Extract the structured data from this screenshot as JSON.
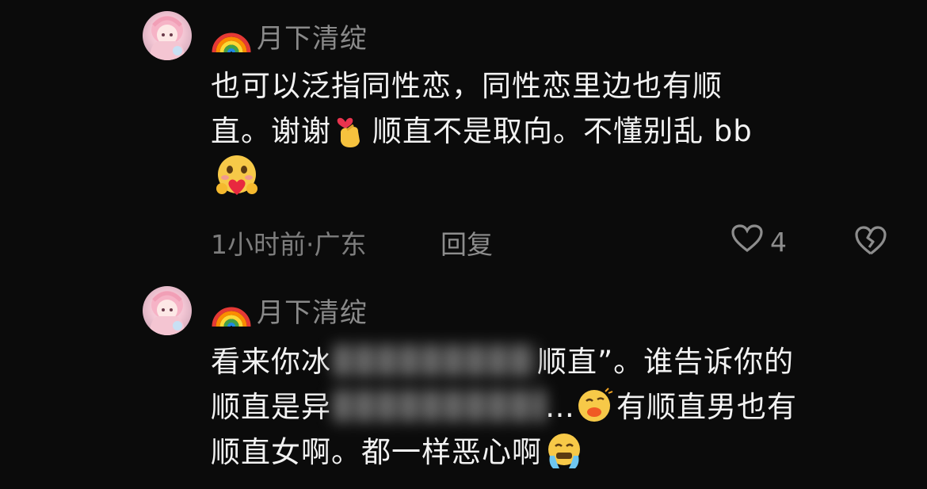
{
  "comments": [
    {
      "username": "月下清绽",
      "badge_icon": "rainbow-icon",
      "lines": [
        {
          "parts": [
            "也可以泛指同性恋，同性恋里边也有顺"
          ]
        },
        {
          "parts": [
            "直。谢谢",
            "顺直不是取向。不懂别乱 bb"
          ]
        }
      ],
      "meta": {
        "time_location": "1小时前·广东",
        "reply_label": "回复",
        "like_count": "4"
      }
    },
    {
      "username": "月下清绽",
      "badge_icon": "rainbow-icon",
      "lines": [
        {
          "parts": [
            "看来你冰",
            "顺直”。谁告诉你的"
          ]
        },
        {
          "parts": [
            "顺直是异",
            "…",
            "有顺直男也有"
          ]
        },
        {
          "parts": [
            "顺直女啊。都一样恶心啊"
          ]
        }
      ]
    }
  ],
  "icons": {
    "heart_outline": "heart-outline-icon",
    "broken_heart": "broken-heart-icon",
    "finger_heart": "finger-heart-emoji",
    "heart_hug": "smiling-heart-emoji",
    "kiss_face": "kissing-face-emoji",
    "crying_face": "crying-face-emoji"
  },
  "colors": {
    "background": "#0b0b0b",
    "text": "#f2f2f2",
    "muted": "#8a8a8a"
  }
}
